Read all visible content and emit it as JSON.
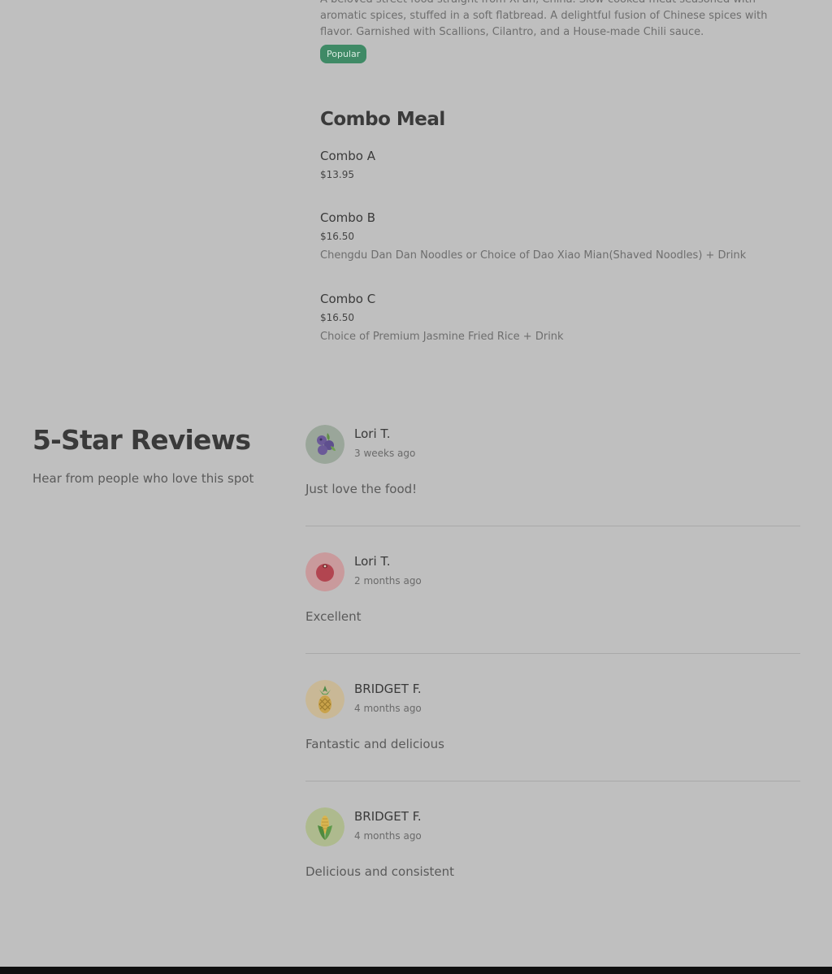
{
  "menu": {
    "previous_item_description": "A beloved street food straight from Xi'an, China. Slow-cooked meat seasoned with aromatic spices, stuffed in a soft flatbread. A delightful fusion of Chinese spices with flavor. Garnished with Scallions, Cilantro, and a House-made Chili sauce.",
    "previous_item_badge": "Popular",
    "section_title": "Combo Meal",
    "items": [
      {
        "name": "Combo A",
        "price": "$13.95",
        "description": ""
      },
      {
        "name": "Combo B",
        "price": "$16.50",
        "description": "Chengdu Dan Dan Noodles or Choice of Dao Xiao Mian(Shaved Noodles) + Drink"
      },
      {
        "name": "Combo C",
        "price": "$16.50",
        "description": "Choice of Premium Jasmine Fried Rice + Drink"
      }
    ]
  },
  "reviews": {
    "title": "5-Star Reviews",
    "subtitle": "Hear from people who love this spot",
    "list": [
      {
        "author": "Lori T.",
        "time": "3 weeks ago",
        "text": "Just love the food!",
        "avatar_icon": "blueberry-icon",
        "avatar_bg": "#9aa69a"
      },
      {
        "author": "Lori T.",
        "time": "2 months ago",
        "text": "Excellent",
        "avatar_icon": "cherry-icon",
        "avatar_bg": "#c99a9c"
      },
      {
        "author": "BRIDGET F.",
        "time": "4 months ago",
        "text": "Fantastic and delicious",
        "avatar_icon": "pineapple-icon",
        "avatar_bg": "#c9b896"
      },
      {
        "author": "BRIDGET F.",
        "time": "4 months ago",
        "text": "Delicious and consistent",
        "avatar_icon": "corn-icon",
        "avatar_bg": "#aeba8e"
      }
    ]
  },
  "colors": {
    "page_background": "#bfbfbf",
    "badge_background": "#3f8a66",
    "footer": "#0f0f0f"
  }
}
